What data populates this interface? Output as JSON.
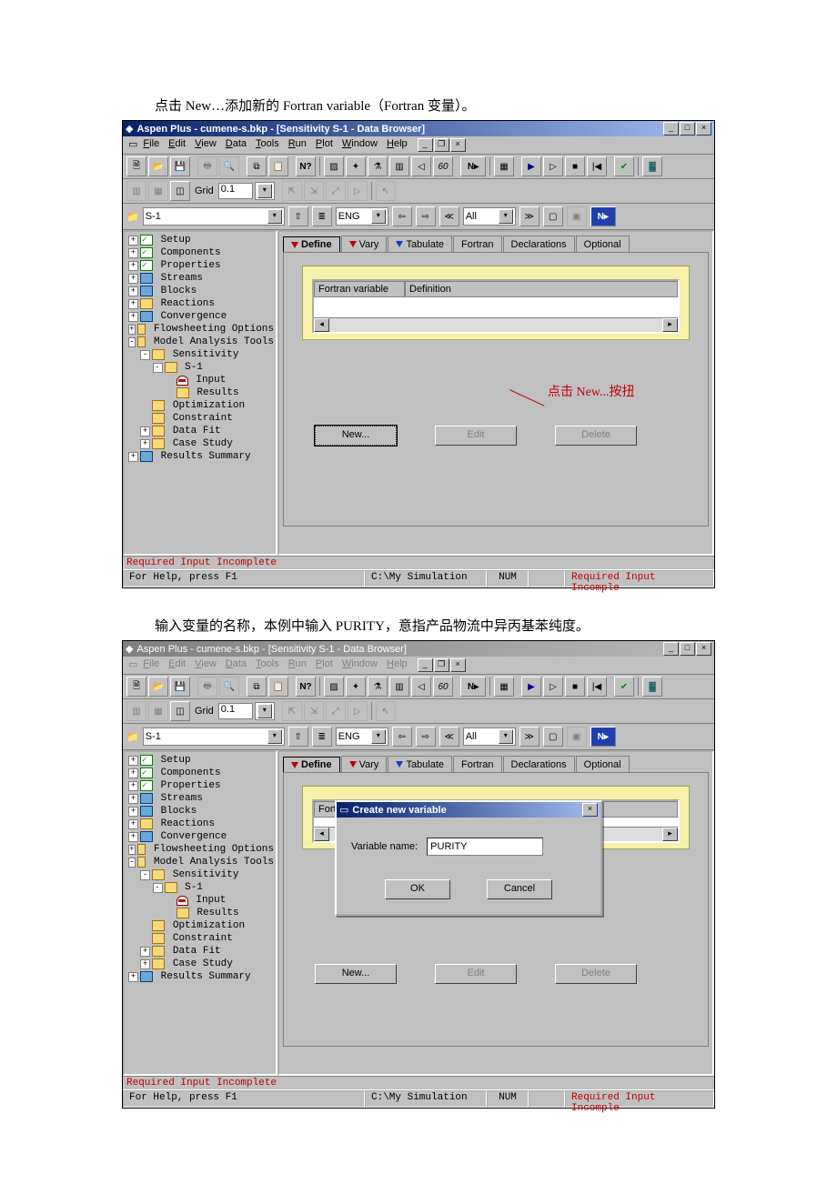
{
  "captions": {
    "top": "点击 New…添加新的 Fortran variable（Fortran 变量）。",
    "bottom": "输入变量的名称，本例中输入 PURITY，意指产品物流中异丙基苯纯度。"
  },
  "app": {
    "title": "Aspen Plus - cumene-s.bkp - [Sensitivity S-1 - Data Browser]",
    "menus": [
      "File",
      "Edit",
      "View",
      "Data",
      "Tools",
      "Run",
      "Plot",
      "Window",
      "Help"
    ]
  },
  "toolbar": {
    "grid_label": "Grid",
    "grid_value": "0.1"
  },
  "navrow": {
    "left_combo": "S-1",
    "units": "ENG",
    "scope": "All"
  },
  "tabs": {
    "items": [
      "Define",
      "Vary",
      "Tabulate",
      "Fortran",
      "Declarations",
      "Optional"
    ],
    "active": "Define"
  },
  "list": {
    "col1": "Fortran variable",
    "col2": "Definition"
  },
  "annot": "点击 New...按扭",
  "buttons": {
    "new": "New...",
    "edit": "Edit",
    "del": "Delete"
  },
  "dialog": {
    "title": "Create new variable",
    "label": "Variable name:",
    "value": "PURITY",
    "ok": "OK",
    "cancel": "Cancel"
  },
  "tree": [
    {
      "indent": 0,
      "exp": "+",
      "icon": "fgreen",
      "label": "Setup"
    },
    {
      "indent": 0,
      "exp": "+",
      "icon": "fgreen",
      "label": "Components"
    },
    {
      "indent": 0,
      "exp": "+",
      "icon": "fgreen",
      "label": "Properties"
    },
    {
      "indent": 0,
      "exp": "+",
      "icon": "fblue",
      "label": "Streams"
    },
    {
      "indent": 0,
      "exp": "+",
      "icon": "fblue",
      "label": "Blocks"
    },
    {
      "indent": 0,
      "exp": "+",
      "icon": "fyellow",
      "label": "Reactions"
    },
    {
      "indent": 0,
      "exp": "+",
      "icon": "fblue",
      "label": "Convergence"
    },
    {
      "indent": 0,
      "exp": "+",
      "icon": "fyellow",
      "label": "Flowsheeting Options"
    },
    {
      "indent": 0,
      "exp": "-",
      "icon": "ffold-open",
      "label": "Model Analysis Tools"
    },
    {
      "indent": 1,
      "exp": "-",
      "icon": "ffold-open",
      "label": "Sensitivity"
    },
    {
      "indent": 2,
      "exp": "-",
      "icon": "ffold-open",
      "label": "S-1"
    },
    {
      "indent": 3,
      "exp": "",
      "icon": "fred",
      "label": "Input"
    },
    {
      "indent": 3,
      "exp": "",
      "icon": "fyellow",
      "label": "Results"
    },
    {
      "indent": 1,
      "exp": "",
      "icon": "fyellow",
      "label": "Optimization"
    },
    {
      "indent": 1,
      "exp": "",
      "icon": "fyellow",
      "label": "Constraint"
    },
    {
      "indent": 1,
      "exp": "+",
      "icon": "fyellow",
      "label": "Data Fit"
    },
    {
      "indent": 1,
      "exp": "+",
      "icon": "fyellow",
      "label": "Case Study"
    },
    {
      "indent": 0,
      "exp": "+",
      "icon": "fblue",
      "label": "Results Summary"
    }
  ],
  "status": {
    "required": "Required Input Incomplete",
    "help": "For Help, press F1",
    "path": "C:\\My Simulation",
    "num": "NUM",
    "rightmsg": "Required Input Incomple"
  }
}
